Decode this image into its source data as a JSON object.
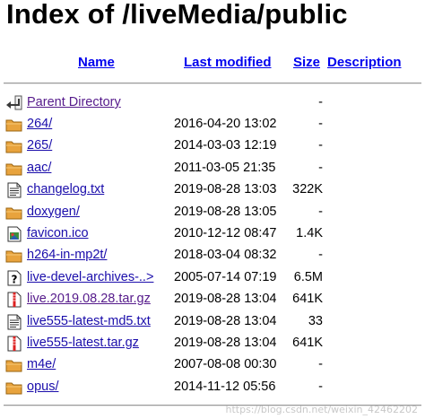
{
  "page": {
    "title": "Index of /liveMedia/public"
  },
  "columns": {
    "name": "Name",
    "last_modified": "Last modified",
    "size": "Size",
    "description": "Description"
  },
  "parent": {
    "label": "Parent Directory",
    "size": "-",
    "icon": "back-arrow-icon"
  },
  "rows": [
    {
      "name": "264/",
      "modified": "2016-04-20 13:02",
      "size": "-",
      "icon": "folder-icon",
      "visited": false
    },
    {
      "name": "265/",
      "modified": "2014-03-03 12:19",
      "size": "-",
      "icon": "folder-icon",
      "visited": false
    },
    {
      "name": "aac/",
      "modified": "2011-03-05 21:35",
      "size": "-",
      "icon": "folder-icon",
      "visited": false
    },
    {
      "name": "changelog.txt",
      "modified": "2019-08-28 13:03",
      "size": "322K",
      "icon": "text-file-icon",
      "visited": false
    },
    {
      "name": "doxygen/",
      "modified": "2019-08-28 13:05",
      "size": "-",
      "icon": "folder-icon",
      "visited": false
    },
    {
      "name": "favicon.ico",
      "modified": "2010-12-12 08:47",
      "size": "1.4K",
      "icon": "image-file-icon",
      "visited": false
    },
    {
      "name": "h264-in-mp2t/",
      "modified": "2018-03-04 08:32",
      "size": "-",
      "icon": "folder-icon",
      "visited": false
    },
    {
      "name": "live-devel-archives-..>",
      "modified": "2005-07-14 07:19",
      "size": "6.5M",
      "icon": "unknown-file-icon",
      "visited": false
    },
    {
      "name": "live.2019.08.28.tar.gz",
      "modified": "2019-08-28 13:04",
      "size": "641K",
      "icon": "compressed-file-icon",
      "visited": true
    },
    {
      "name": "live555-latest-md5.txt",
      "modified": "2019-08-28 13:04",
      "size": "33",
      "icon": "text-file-icon",
      "visited": false
    },
    {
      "name": "live555-latest.tar.gz",
      "modified": "2019-08-28 13:04",
      "size": "641K",
      "icon": "compressed-file-icon",
      "visited": false
    },
    {
      "name": "m4e/",
      "modified": "2007-08-08 00:30",
      "size": "-",
      "icon": "folder-icon",
      "visited": false
    },
    {
      "name": "opus/",
      "modified": "2014-11-12 05:56",
      "size": "-",
      "icon": "folder-icon",
      "visited": false
    }
  ],
  "watermark": "https://blog.csdn.net/weixin_42462202",
  "colors": {
    "link": "#1a0dab",
    "visited": "#551a8b",
    "header_link": "#0000ee",
    "folder": "#e8a33d"
  }
}
